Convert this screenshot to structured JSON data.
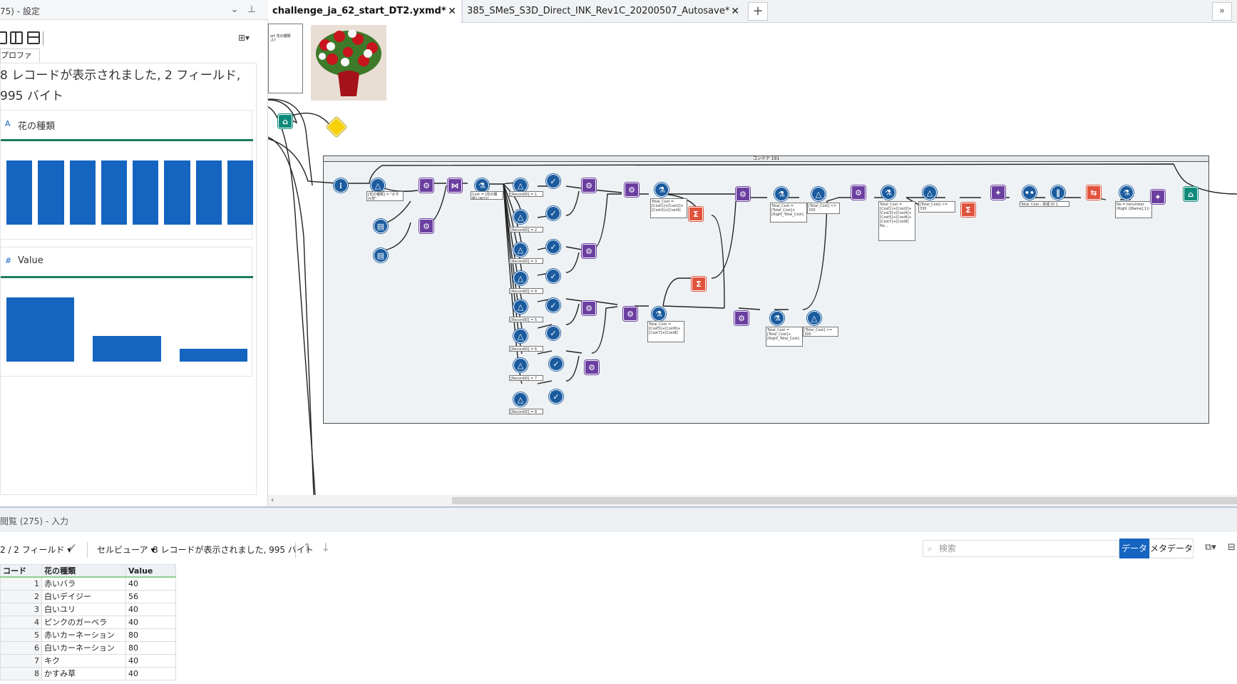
{
  "config_panel": {
    "title": "75) - 設定",
    "tab_profile": "プロファイル",
    "summary_line1": "8 レコードが表示されました, 2 フィールド,",
    "summary_line2": "995 バイト",
    "field1_title": "花の種類",
    "field1_type_icon": "A",
    "field2_title": "Value",
    "field2_type_icon": "#",
    "chart1": {
      "type": "bar",
      "values": [
        1,
        1,
        1,
        1,
        1,
        1,
        1,
        1
      ]
    },
    "chart2": {
      "type": "bar",
      "values": [
        5,
        2,
        1
      ]
    }
  },
  "tabs": [
    {
      "label": "challenge_ja_62_start_DT2.yxmd*"
    },
    {
      "label": "385_SMeS_S3D_Direct_INK_Rev1C_20200507_Autosave*"
    }
  ],
  "canvas": {
    "comment_text": "ort 花の種類\nス?",
    "container_title": "コンテナ 191",
    "labels": {
      "filter1": "[花の種類] = \"かす み草\"",
      "formula1": "Cost = [花の種類] [NO2]",
      "rec1": "[RecordID] = 1",
      "rec2": "[RecordID] = 2",
      "rec3": "[RecordID] = 3",
      "rec4": "[RecordID] = 4",
      "rec5": "[RecordID] = 5",
      "rec6": "[RecordID] = 6",
      "rec7": "[RecordID] = 7",
      "rec8": "[RecordID] = 8",
      "tc1": "Total_Cost = [Cost1]+[Cost2]+[Cost3]+[Cost4]",
      "tc2": "Total_Cost = [Cost5]+[Cost6]+[Cost7]+[Cost8]",
      "tc3": "Total_Cost = [Total_Cost]+[Right_Total_Cost]",
      "tc4": "[Total_Cost] <= 330",
      "tc5": "Total_Cost = [Total_Cost]+[Right_Total_Cost]",
      "tc6": "[Total_Cost] <= 330",
      "tc7": "Total_Cost = [Cost1]+[Cost2]+[Cost3]+[Cost4]+[Cost5]+[Cost6]+[Cost7]+[Cost8] No...",
      "tc8": "[Total_Cost] <= 330",
      "tc9": "Total_Cost - 昇順 ID 1",
      "tc10": "No = tonumber (Right ([Name],1))"
    }
  },
  "results": {
    "header": "閲覧 (275) - 入力",
    "fields_selector": "2 / 2 フィールド",
    "viewer": "セルビューア",
    "summary": "8 レコードが表示されました, 995 バイト",
    "search_placeholder": "検索",
    "btn_data": "データ",
    "btn_meta": "メタデータ",
    "columns": [
      "コード",
      "花の種類",
      "Value"
    ],
    "rows": [
      {
        "id": "1",
        "name": "赤いバラ",
        "value": "40"
      },
      {
        "id": "2",
        "name": "白いデイジー",
        "value": "56"
      },
      {
        "id": "3",
        "name": "白いユリ",
        "value": "40"
      },
      {
        "id": "4",
        "name": "ピンクのガーベラ",
        "value": "40"
      },
      {
        "id": "5",
        "name": "赤いカーネーション",
        "value": "80"
      },
      {
        "id": "6",
        "name": "白いカーネーション",
        "value": "80"
      },
      {
        "id": "7",
        "name": "キク",
        "value": "40"
      },
      {
        "id": "8",
        "name": "かすみ草",
        "value": "40"
      }
    ]
  },
  "colors": {
    "accent": "#1565c0",
    "green": "#1e7d5c",
    "node_blue": "#1b5b9e",
    "node_purple": "#6b3fa0"
  }
}
